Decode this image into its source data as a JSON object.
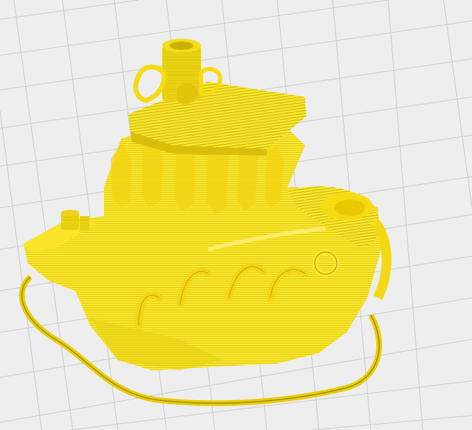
{
  "viewport": {
    "view": "layer-preview",
    "background_color": "#eeeeee",
    "grid_color": "#c7c7c7",
    "model": {
      "name": "boat-model-sliced",
      "parts": [
        "cabin",
        "chimney",
        "roof",
        "hull",
        "bow",
        "stern-deck",
        "skirt"
      ],
      "extrusion_color": "#fde82b",
      "layer_line_color": "#a89a00",
      "shadow_color": "#e5cf12"
    }
  }
}
